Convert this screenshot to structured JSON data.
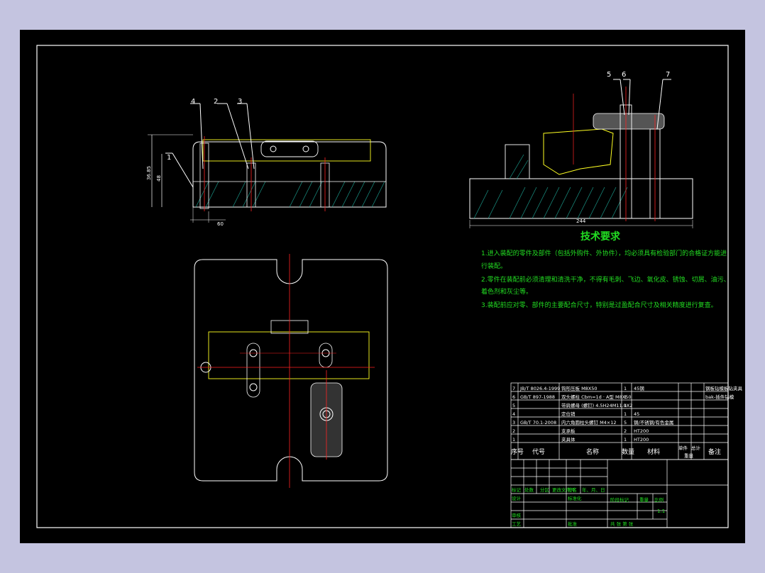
{
  "drawing": {
    "title_requirements": "技术要求",
    "requirements": [
      "1.进入装配的零件及部件（包括外购件、外协件），均必须具有检验部门的合格证方能进",
      "行装配。",
      "2.零件在装配前必须清理和清洗干净，不得有毛刺、飞边、氧化皮、锈蚀、切屑、油污、",
      "着色剂和灰尘等。",
      "3.装配前应对零、部件的主要配合尺寸，特别是过盈配合尺寸及相关精度进行复查。"
    ],
    "balloons_left": [
      "4",
      "2",
      "3",
      "1"
    ],
    "balloons_right": [
      "5",
      "6",
      "7"
    ],
    "dims_left": [
      "36.85",
      "48",
      "60"
    ],
    "dims_right": [
      "244"
    ],
    "scale": "1:1"
  },
  "bom": {
    "rows": [
      {
        "no": "7",
        "code": "JB/T 8026.4-1999",
        "name": "钩形压板 M8X50",
        "qty": "1",
        "material": "45钢"
      },
      {
        "no": "6",
        "code": "GB/T 897-1988",
        "name": "双头螺柱 Cbm=1d · A型 M8X50",
        "qty": "1",
        "material": ""
      },
      {
        "no": "5",
        "code": "",
        "name": "带肩螺母 (螺钉) 4.5H24M11.0X2",
        "qty": "1",
        "material": ""
      },
      {
        "no": "4",
        "code": "",
        "name": "定位销",
        "qty": "1",
        "material": "45"
      },
      {
        "no": "3",
        "code": "GB/T 70.1-2008",
        "name": "内六角圆柱头螺钉 M4×12",
        "qty": "5",
        "material": "钢/不锈钢/有色金属"
      },
      {
        "no": "2",
        "code": "",
        "name": "支承板",
        "qty": "2",
        "material": "HT200"
      },
      {
        "no": "1",
        "code": "",
        "name": "夹具体",
        "qty": "1",
        "material": "HT200"
      }
    ],
    "side_notes": [
      "钢板钻模板钻夹具",
      "bak-插件钻模"
    ],
    "header": {
      "no": "序号",
      "code": "代号",
      "name": "名称",
      "qty": "数量",
      "material": "材料",
      "single": "单件",
      "total": "总计",
      "weight": "重量",
      "remark": "备注"
    }
  },
  "title_block": {
    "labels": [
      "标记",
      "处数",
      "分区",
      "更改文件号",
      "签名",
      "年、月、日"
    ],
    "design": "设计",
    "standard": "标准化",
    "stage": "阶段标记",
    "weight": "重量",
    "ratio": "比例",
    "review": "审核",
    "process": "工艺",
    "approve": "批准",
    "sheets": "共 张 第 张"
  }
}
